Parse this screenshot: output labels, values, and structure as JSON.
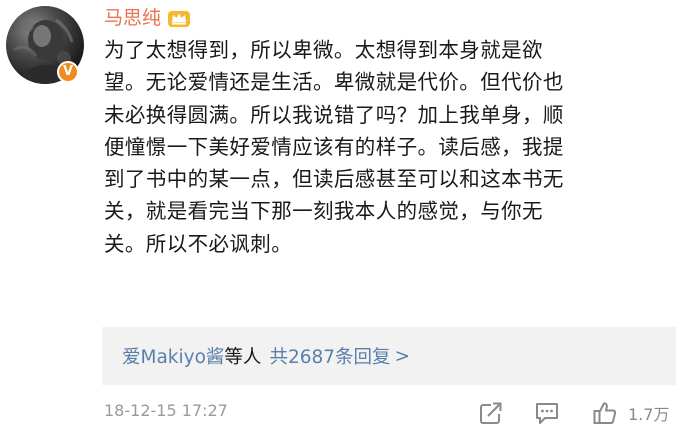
{
  "comment": {
    "username": "马思纯",
    "avatar_icon": "avatar-photo",
    "verified_icon": "verified-v-icon",
    "vip_icon": "crown-icon",
    "lines": [
      "为了太想得到，所以卑微。太想得到本身就是欲",
      "望。无论爱情还是生活。卑微就是代价。但代价也",
      "未必换得圆满。所以我说错了吗？加上我单身，顺",
      "便憧憬一下美好爱情应该有的样子。读后感，我提",
      "到了书中的某一点，但读后感甚至可以和这本书无",
      "关，就是看完当下那一刻我本人的感觉，与你无",
      "关。所以不必讽刺。"
    ],
    "replies": {
      "users": "爱Makiyo酱",
      "suffix": "等人",
      "count_text": "共2687条回复",
      "arrow": ">"
    },
    "footer": {
      "timestamp": "18-12-15 17:27",
      "like_count": "1.7万",
      "icons": [
        "share-icon",
        "comment-icon",
        "like-icon"
      ]
    }
  },
  "colors": {
    "username": "#eb7350",
    "link": "#5b7fab",
    "text": "#1a1a1a",
    "meta": "#9a9a9a",
    "reply_bg": "#f2f2f2",
    "verified": "#f08b1f"
  }
}
